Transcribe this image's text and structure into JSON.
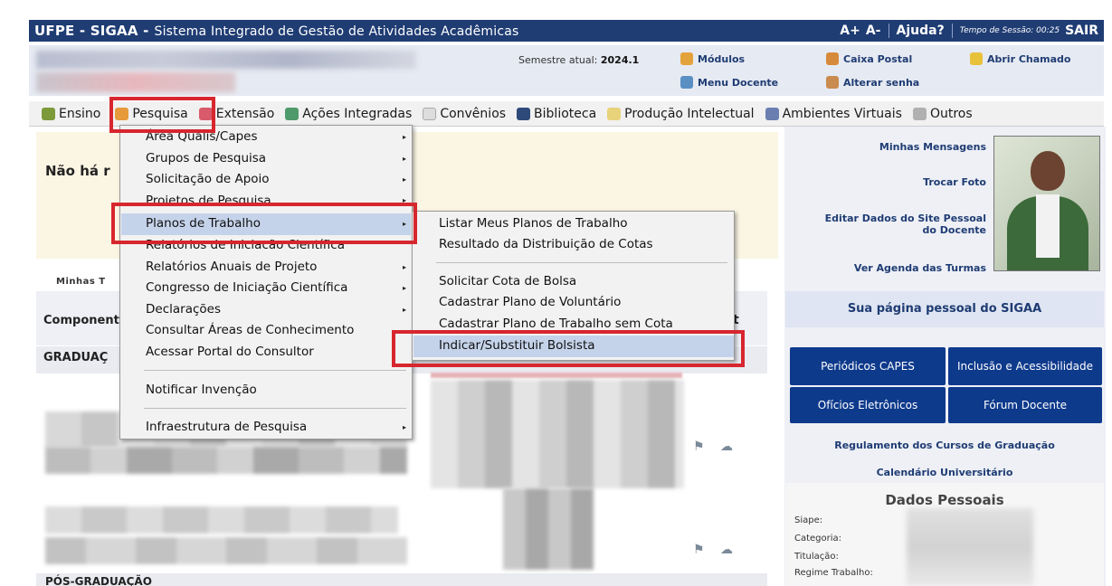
{
  "topbar": {
    "system_title": "UFPE - SIGAA -",
    "system_subtitle": "Sistema Integrado de Gestão de Atividades Acadêmicas",
    "font_plus": "A+",
    "font_minus": "A-",
    "help": "Ajuda?",
    "session": "Tempo de Sessão: 00:25",
    "exit": "SAIR",
    "color": "#1f3c73"
  },
  "info": {
    "semester_label": "Semestre atual:",
    "semester_value": "2024.1",
    "modulos": "Módulos",
    "caixa_postal": "Caixa Postal",
    "abrir_chamado": "Abrir Chamado",
    "menu_docente": "Menu Docente",
    "alterar_senha": "Alterar senha"
  },
  "main_menu": {
    "items": [
      {
        "label": "Ensino",
        "icon": "ensino-icon"
      },
      {
        "label": "Pesquisa",
        "icon": "pesquisa-icon"
      },
      {
        "label": "Extensão",
        "icon": "extensao-icon"
      },
      {
        "label": "Ações Integradas",
        "icon": "acoes-icon"
      },
      {
        "label": "Convênios",
        "icon": "convenios-icon"
      },
      {
        "label": "Biblioteca",
        "icon": "biblioteca-icon"
      },
      {
        "label": "Produção Intelectual",
        "icon": "producao-icon"
      },
      {
        "label": "Ambientes Virtuais",
        "icon": "ambientes-icon"
      },
      {
        "label": "Outros",
        "icon": "outros-icon"
      }
    ]
  },
  "content": {
    "nao_ha": "Não há r",
    "minhas_t": "Minhas T",
    "componente": "Component",
    "graduacao": "GRADUAÇ",
    "pos_graduacao": "PÓS-GRADUAÇÃO",
    "partial_t": "t"
  },
  "dropdown": {
    "items": [
      "Área Qualis/Capes",
      "Grupos de Pesquisa",
      "Solicitação de Apoio",
      "Projetos de Pesquisa",
      "Planos de Trabalho",
      "Relatórios de Iniciação Científica",
      "Relatórios Anuais de Projeto",
      "Congresso de Iniciação Científica",
      "Declarações",
      "Consultar Áreas de Conhecimento",
      "Acessar Portal do Consultor",
      "Notificar Invenção",
      "Infraestrutura de Pesquisa"
    ],
    "arrow": "▸",
    "highlight_color": "#c5d3ea"
  },
  "submenu": {
    "items": [
      "Listar Meus Planos de Trabalho",
      "Resultado da Distribuição de Cotas",
      "Solicitar Cota de Bolsa",
      "Cadastrar Plano de Voluntário",
      "Cadastrar Plano de Trabalho sem Cota",
      "Indicar/Substituir Bolsista"
    ]
  },
  "right": {
    "minhas_mensagens": "Minhas Mensagens",
    "trocar_foto": "Trocar Foto",
    "editar_dados_1": "Editar Dados do Site Pessoal",
    "editar_dados_2": "do Docente",
    "ver_agenda": "Ver Agenda das Turmas",
    "pagina_pessoal": "Sua página pessoal do SIGAA",
    "buttons": [
      "Periódicos CAPES",
      "Inclusão e Acessibilidade",
      "Ofícios Eletrônicos",
      "Fórum Docente"
    ],
    "regulamento": "Regulamento dos Cursos de Graduação",
    "calendario": "Calendário Universitário",
    "dados_pessoais": "Dados Pessoais",
    "siape": "Siape:",
    "categoria": "Categoria:",
    "titulacao": "Titulação:",
    "regime": "Regime Trabalho:",
    "button_color": "#0e3a8c"
  },
  "highlight": {
    "color": "#d7262e"
  }
}
